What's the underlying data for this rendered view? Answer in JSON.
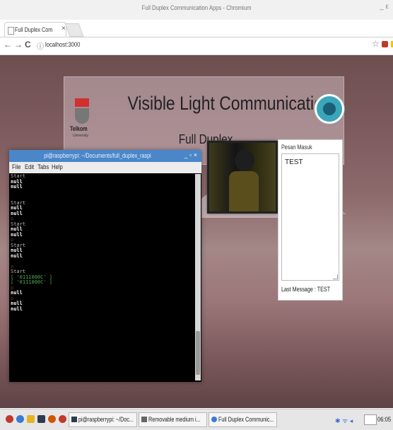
{
  "browser": {
    "window_title": "Full Duplex Communication Apps - Chromium",
    "minimize_label": "_ ε",
    "tab_label": "Full Duplex Com",
    "tab_close": "×",
    "url": "localhost:3000",
    "nav": {
      "back": "←",
      "forward": "→",
      "reload": "C",
      "info": "ⓘ"
    },
    "star": "☆"
  },
  "header": {
    "title": "Visible Light Communication",
    "subtitle": "Full Duplex",
    "logo_text": "Telkom",
    "logo_subtext": "University"
  },
  "message_panel": {
    "label": "Pesan Masuk",
    "value": "TEST",
    "last_message": "Last Message : TEST"
  },
  "terminal": {
    "title": "pi@raspberrypi: ~/Documents/full_duplex_raspi",
    "controls": "_ ▫ ×",
    "menu": [
      "File",
      "Edit",
      "Tabs",
      "Help"
    ],
    "lines": [
      {
        "text": "Start",
        "kind": "start"
      },
      {
        "text": "null",
        "kind": "null"
      },
      {
        "text": "null",
        "kind": "null"
      },
      {
        "text": "",
        "kind": "blank"
      },
      {
        "text": "",
        "kind": "blank"
      },
      {
        "text": "Start",
        "kind": "start"
      },
      {
        "text": "null",
        "kind": "null"
      },
      {
        "text": "null",
        "kind": "null"
      },
      {
        "text": "p",
        "kind": "dim"
      },
      {
        "text": "Start",
        "kind": "start"
      },
      {
        "text": "null",
        "kind": "null"
      },
      {
        "text": "null",
        "kind": "null"
      },
      {
        "text": "p",
        "kind": "dim"
      },
      {
        "text": "Start",
        "kind": "start"
      },
      {
        "text": "null",
        "kind": "null"
      },
      {
        "text": "null",
        "kind": "null"
      },
      {
        "text": "",
        "kind": "blank"
      },
      {
        "text": "p",
        "kind": "dim"
      },
      {
        "text": "Start",
        "kind": "start"
      },
      {
        "text": "[ '0111000C' ]",
        "kind": "green"
      },
      {
        "text": "[ '0111000C' ]",
        "kind": "green"
      },
      {
        "text": "p",
        "kind": "dim"
      },
      {
        "text": "null",
        "kind": "null"
      },
      {
        "text": "p",
        "kind": "dim"
      },
      {
        "text": "null",
        "kind": "null"
      },
      {
        "text": "null",
        "kind": "null"
      }
    ]
  },
  "taskbar": {
    "tasks": [
      {
        "label": "pi@raspberrypi: ~/Doc...",
        "color": "#2e3b4e"
      },
      {
        "label": "Removable medium i...",
        "color": "#666666"
      },
      {
        "label": "Full Duplex Communic...",
        "color": "#3a7bd5"
      }
    ],
    "tray": "✱ ᯤ ◂",
    "battery": "  ",
    "time": "06:05"
  }
}
